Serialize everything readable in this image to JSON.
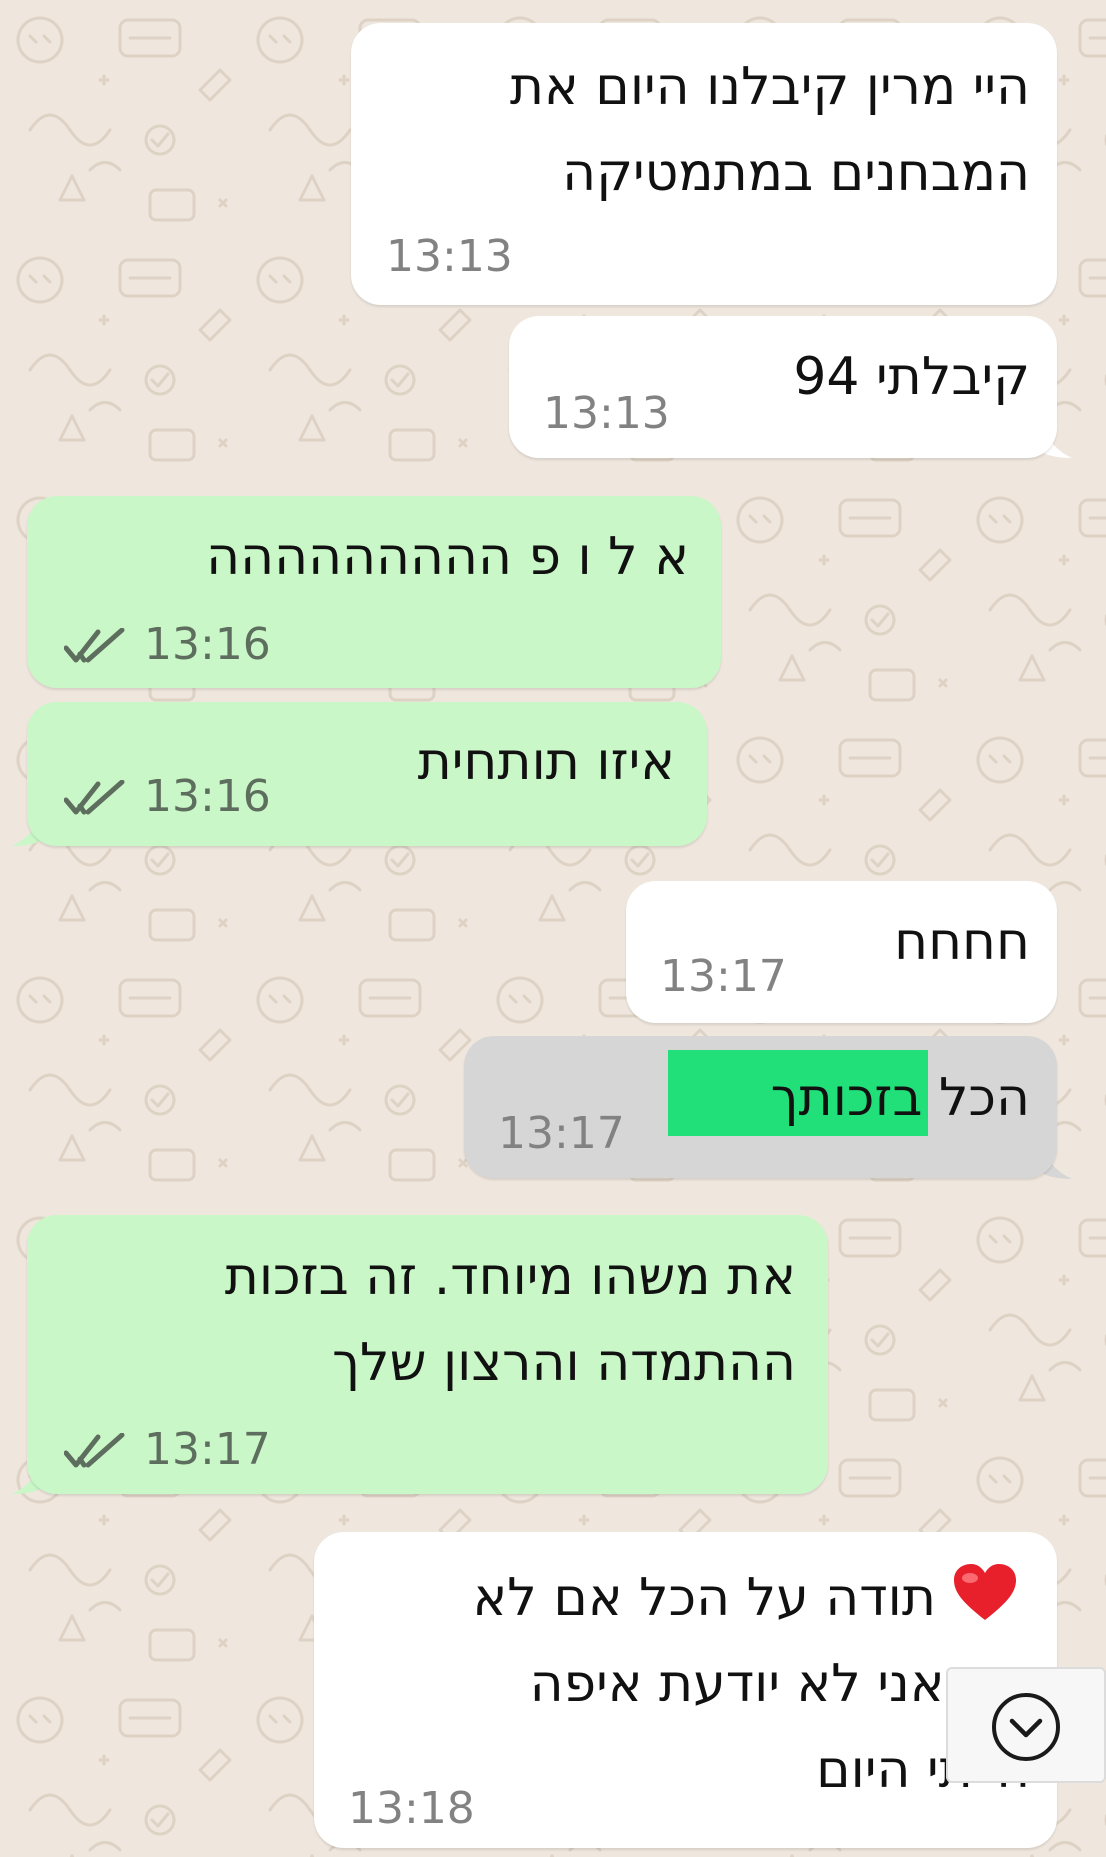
{
  "chat": {
    "messages": [
      {
        "id": "m1",
        "direction": "incoming",
        "lines": [
          "היי מרין קיבלנו היום את",
          "המבחנים במתמטיקה"
        ],
        "time": "13:13"
      },
      {
        "id": "m2",
        "direction": "incoming",
        "lines": [
          "קיבלתי 94"
        ],
        "time": "13:13"
      },
      {
        "id": "m3",
        "direction": "outgoing",
        "lines": [
          "א ל ו פ ההההההההה"
        ],
        "time": "13:16",
        "status": "read"
      },
      {
        "id": "m4",
        "direction": "outgoing",
        "lines": [
          "איזו תותחית"
        ],
        "time": "13:16",
        "status": "read"
      },
      {
        "id": "m5",
        "direction": "incoming",
        "lines": [
          "חחחח"
        ],
        "time": "13:17"
      },
      {
        "id": "m6",
        "direction": "incoming",
        "lines": [
          "הכל בזכותך"
        ],
        "time": "13:17",
        "selected": true
      },
      {
        "id": "m7",
        "direction": "outgoing",
        "lines": [
          "את משהו מיוחד. זה בזכות",
          "ההתמדה והרצון שלך"
        ],
        "time": "13:17",
        "status": "read"
      },
      {
        "id": "m8",
        "direction": "incoming",
        "emoji": "red-heart-emoji",
        "lines": [
          "תודה על הכל אם לא",
          "את אני לא יודעת איפה",
          "הייתי היום"
        ],
        "time": "13:18"
      }
    ]
  },
  "scroll_button": {
    "icon": "chevron-down-circle-icon"
  },
  "colors": {
    "background": "#efe7de",
    "incoming_bubble": "#ffffff",
    "outgoing_bubble": "#c9f7c7",
    "selected_bubble": "#d6d6d6",
    "text_highlight": "#21e07a",
    "time_text": "#828282",
    "read_ticks": "#5e6e5e",
    "heart": "#e8202c"
  }
}
